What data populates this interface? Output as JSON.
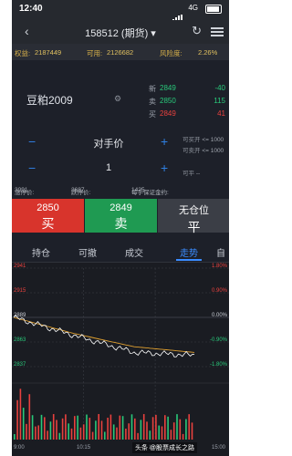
{
  "status_bar": {
    "time": "12:40",
    "network": "4G"
  },
  "nav": {
    "title": "158512 (期货) ▾"
  },
  "account": {
    "equity_label": "权益:",
    "equity": "2187449",
    "avail_label": "可用:",
    "avail": "2126682",
    "risk_label": "风险度:",
    "risk": "2.26%"
  },
  "quote": {
    "name": "豆粕2009",
    "rows": [
      {
        "label": "新",
        "price": "2849",
        "change": "-40",
        "color": "#29c87a"
      },
      {
        "label": "卖",
        "price": "2850",
        "change": "115",
        "color": "#29c87a"
      },
      {
        "label": "买",
        "price": "2849",
        "change": "41",
        "color": "#e8413e"
      }
    ]
  },
  "price_row": {
    "label": "对手价",
    "side_open": "可买开",
    "side_open_val": "<= 1000",
    "side_close": "可卖开",
    "side_close_val": "<= 1000"
  },
  "qty_row": {
    "value": "1",
    "side_flat": "可平",
    "side_flat_val": "--"
  },
  "limits": {
    "up_label": "涨停价:",
    "up": "3091",
    "down_label": "跌停价:",
    "down": "2687",
    "margin_label": "每手保证金约:",
    "margin": "1425"
  },
  "buttons": {
    "buy_price": "2850",
    "buy_label": "买",
    "sell_price": "2849",
    "sell_label": "卖",
    "flat_price": "无仓位",
    "flat_label": "平"
  },
  "tabs": [
    "持仓",
    "可撤",
    "成交",
    "走势",
    "自"
  ],
  "active_tab": 3,
  "chart_labels": {
    "y_left": [
      "2941",
      "2915",
      "2889",
      "2863",
      "2837"
    ],
    "y_right": [
      "1.80%",
      "0.90%",
      "0.00%",
      "-0.90%",
      "-1.80%"
    ],
    "x_labels": [
      "9:00",
      "10:15",
      "13:30",
      "15:00"
    ],
    "mid_label": "—"
  },
  "chart_data": {
    "type": "line",
    "title": "",
    "x": [
      "9:00",
      "10:15",
      "13:30",
      "15:00"
    ],
    "series": [
      {
        "name": "",
        "values": [
          2889,
          2870,
          2852,
          2849
        ]
      },
      {
        "name": "",
        "values": [
          2889,
          2872,
          2858,
          2852
        ]
      }
    ],
    "ylim": [
      2837,
      2941
    ]
  },
  "watermark": "头条 @股票成长之路",
  "colors": {
    "buy": "#d8342c",
    "sell": "#1f9a52",
    "flat": "#3b3e46",
    "accent": "#3a8cff"
  }
}
